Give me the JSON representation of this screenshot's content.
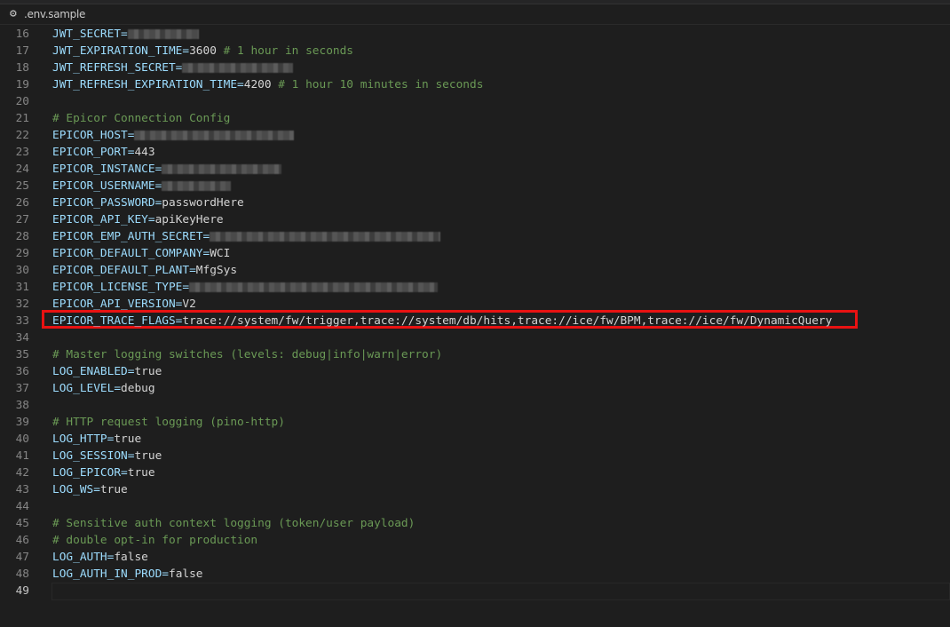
{
  "tab": {
    "icon": "gear-icon",
    "title": ".env.sample"
  },
  "lines": [
    {
      "n": "16",
      "key": "JWT_SECRET=",
      "redacted_width": 80
    },
    {
      "n": "17",
      "key": "JWT_EXPIRATION_TIME=",
      "value": "3600",
      "comment": " # 1 hour in seconds"
    },
    {
      "n": "18",
      "key": "JWT_REFRESH_SECRET=",
      "redacted_width": 125
    },
    {
      "n": "19",
      "key": "JWT_REFRESH_EXPIRATION_TIME=",
      "value": "4200",
      "comment": " # 1 hour 10 minutes in seconds"
    },
    {
      "n": "20"
    },
    {
      "n": "21",
      "comment": "# Epicor Connection Config"
    },
    {
      "n": "22",
      "key": "EPICOR_HOST=",
      "redacted_width": 180
    },
    {
      "n": "23",
      "key": "EPICOR_PORT=",
      "value": "443"
    },
    {
      "n": "24",
      "key": "EPICOR_INSTANCE=",
      "redacted_width": 135
    },
    {
      "n": "25",
      "key": "EPICOR_USERNAME=",
      "redacted_width": 78
    },
    {
      "n": "26",
      "key": "EPICOR_PASSWORD=",
      "value": "passwordHere"
    },
    {
      "n": "27",
      "key": "EPICOR_API_KEY=",
      "value": "apiKeyHere"
    },
    {
      "n": "28",
      "key": "EPICOR_EMP_AUTH_SECRET=",
      "redacted_width": 260
    },
    {
      "n": "29",
      "key": "EPICOR_DEFAULT_COMPANY=",
      "value": "WCI"
    },
    {
      "n": "30",
      "key": "EPICOR_DEFAULT_PLANT=",
      "value": "MfgSys"
    },
    {
      "n": "31",
      "key": "EPICOR_LICENSE_TYPE=",
      "redacted_width": 280
    },
    {
      "n": "32",
      "key": "EPICOR_API_VERSION=",
      "value": "V2"
    },
    {
      "n": "33",
      "key": "EPICOR_TRACE_FLAGS=",
      "value": "trace://system/fw/trigger,trace://system/db/hits,trace://ice/fw/BPM,trace://ice/fw/DynamicQuery",
      "highlighted": true
    },
    {
      "n": "34"
    },
    {
      "n": "35",
      "comment": "# Master logging switches (levels: debug|info|warn|error)"
    },
    {
      "n": "36",
      "key": "LOG_ENABLED=",
      "value": "true"
    },
    {
      "n": "37",
      "key": "LOG_LEVEL=",
      "value": "debug"
    },
    {
      "n": "38"
    },
    {
      "n": "39",
      "comment": "# HTTP request logging (pino-http)"
    },
    {
      "n": "40",
      "key": "LOG_HTTP=",
      "value": "true"
    },
    {
      "n": "41",
      "key": "LOG_SESSION=",
      "value": "true"
    },
    {
      "n": "42",
      "key": "LOG_EPICOR=",
      "value": "true"
    },
    {
      "n": "43",
      "key": "LOG_WS=",
      "value": "true"
    },
    {
      "n": "44"
    },
    {
      "n": "45",
      "comment": "# Sensitive auth context logging (token/user payload)"
    },
    {
      "n": "46",
      "comment": "# double opt-in for production"
    },
    {
      "n": "47",
      "key": "LOG_AUTH=",
      "value": "false"
    },
    {
      "n": "48",
      "key": "LOG_AUTH_IN_PROD=",
      "value": "false"
    },
    {
      "n": "49",
      "current": true
    }
  ]
}
